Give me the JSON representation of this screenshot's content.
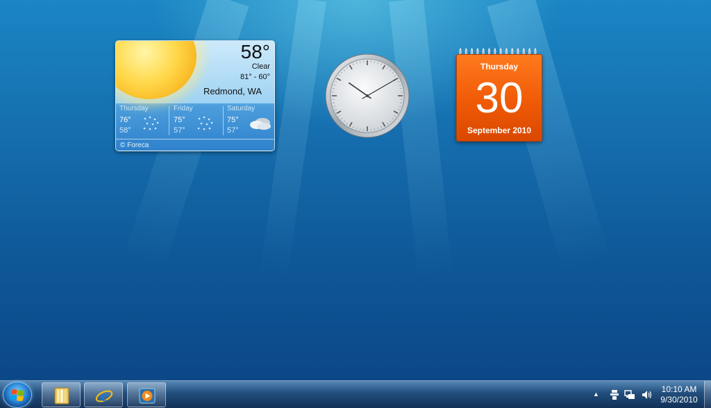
{
  "weather": {
    "temperature": "58°",
    "condition": "Clear",
    "range": "81° - 60°",
    "location": "Redmond, WA",
    "forecast": [
      {
        "day": "Thursday",
        "high": "76°",
        "low": "58°",
        "icon": "rain-icon"
      },
      {
        "day": "Friday",
        "high": "75°",
        "low": "57°",
        "icon": "rain-icon"
      },
      {
        "day": "Saturday",
        "high": "75°",
        "low": "57°",
        "icon": "cloudy-icon"
      }
    ],
    "provider": "© Foreca",
    "icon": "sunny-icon"
  },
  "clock": {
    "hour": 10,
    "minute": 10
  },
  "calendar": {
    "weekday": "Thursday",
    "day": "30",
    "month_year": "September 2010",
    "color": "#f05a06"
  },
  "taskbar": {
    "start_icon": "windows-logo-icon",
    "pinned": [
      {
        "name": "windows-explorer-button",
        "icon": "folder-library-icon"
      },
      {
        "name": "internet-explorer-button",
        "icon": "internet-explorer-icon"
      },
      {
        "name": "windows-media-player-button",
        "icon": "media-player-icon"
      }
    ],
    "tray": {
      "show_hidden": "▲",
      "icons": [
        "action-center-icon",
        "network-icon",
        "volume-icon"
      ]
    },
    "time": "10:10 AM",
    "date": "9/30/2010"
  }
}
